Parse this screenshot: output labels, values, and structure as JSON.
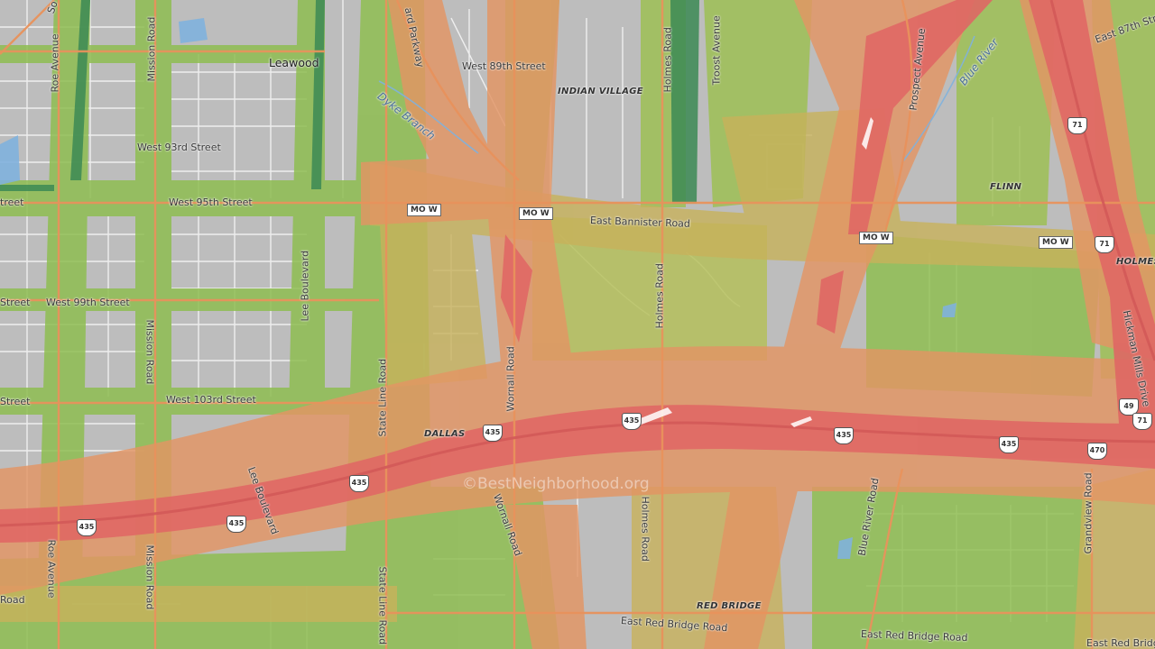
{
  "map": {
    "watermark": "©BestNeighborhood.org",
    "colors": {
      "high": "#e36a66",
      "mid_high": "#ea8d63",
      "mid": "#d8a86a",
      "low_mid": "#c8b25b",
      "low": "#8fbe52",
      "lowest": "#3c8a55",
      "land": "#bfbfbf",
      "roads": "#ffffff",
      "water": "#7fb1dd"
    },
    "cities": {
      "leawood": "Leawood"
    },
    "neighborhoods": {
      "indian_village": "INDIAN VILLAGE",
      "flinn": "FLINN",
      "dallas": "DALLAS",
      "red_bridge": "RED BRIDGE",
      "holmes": "HOLMES"
    },
    "water": {
      "dyke_branch": "Dyke Branch",
      "blue_river": "Blue River"
    },
    "streets": {
      "roe_avenue": "Roe Avenue",
      "mission_road": "Mission Road",
      "state_line_road": "State Line Road",
      "wornall_road": "Wornall Road",
      "holmes_road": "Holmes Road",
      "troost_avenue": "Troost Avenue",
      "prospect_avenue": "Prospect Avenue",
      "lee_boulevard": "Lee Boulevard",
      "blue_river_road": "Blue River Road",
      "grandview_road": "Grandview Road",
      "hickman_mills_drive": "Hickman Mills Drive",
      "west_89th": "West 89th Street",
      "west_93rd": "West 93rd Street",
      "west_95th": "West 95th Street",
      "west_99th": "West 99th Street",
      "west_103rd": "West 103rd Street",
      "east_87th": "East 87th Street",
      "east_bannister": "East Bannister Road",
      "east_red_bridge": "East Red Bridge Road",
      "street_cut": "Street",
      "street_cut_short": "treet",
      "road_cut": "Road",
      "ward_parkway_cut": "ard Parkway",
      "side_ave_cut": "So",
      "red_bridge_cut": "East Red Bridg"
    },
    "shields": {
      "mo_w": "MO W",
      "i435": "435",
      "i470": "470",
      "i49": "49",
      "us71": "71"
    }
  }
}
